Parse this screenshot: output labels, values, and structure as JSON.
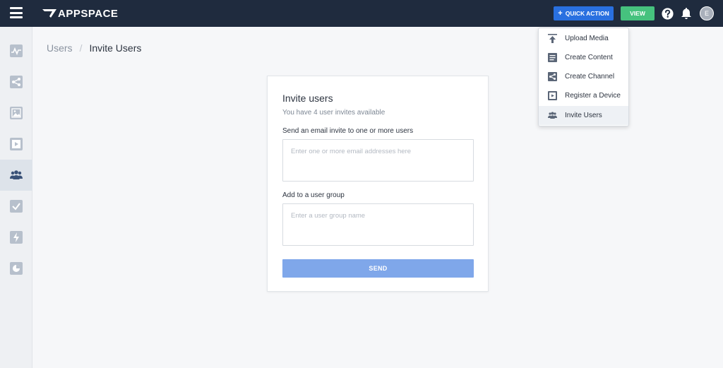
{
  "header": {
    "logo_text": "APPSPACE",
    "quick_action_label": "QUICK ACTION",
    "quick_action_plus": "+",
    "view_label": "VIEW",
    "avatar_initial": "E"
  },
  "sidebar": {
    "items": [
      {
        "icon": "activity-icon"
      },
      {
        "icon": "share-icon"
      },
      {
        "icon": "image-icon"
      },
      {
        "icon": "play-icon"
      },
      {
        "icon": "users-icon",
        "active": true
      },
      {
        "icon": "check-icon"
      },
      {
        "icon": "bolt-icon"
      },
      {
        "icon": "pie-chart-icon"
      }
    ]
  },
  "breadcrumb": {
    "parent": "Users",
    "separator": "/",
    "current": "Invite Users"
  },
  "invite_card": {
    "title": "Invite users",
    "subtitle": "You have 4 user invites available",
    "email_label": "Send an email invite to one or more users",
    "email_placeholder": "Enter one or more email addresses here",
    "group_label": "Add to a user group",
    "group_placeholder": "Enter a user group name",
    "send_label": "SEND"
  },
  "quick_action_menu": {
    "items": [
      {
        "label": "Upload Media",
        "icon": "upload-icon"
      },
      {
        "label": "Create Content",
        "icon": "document-icon"
      },
      {
        "label": "Create Channel",
        "icon": "share-icon"
      },
      {
        "label": "Register a Device",
        "icon": "device-icon"
      },
      {
        "label": "Invite Users",
        "icon": "users-icon",
        "highlighted": true
      }
    ]
  },
  "colors": {
    "topbar": "#1f2b3e",
    "quick_action": "#2970e0",
    "view": "#46c27e",
    "send_button": "#7fa7ea",
    "sidebar_icon": "#b7c0cc",
    "sidebar_active_icon": "#3a5278"
  }
}
